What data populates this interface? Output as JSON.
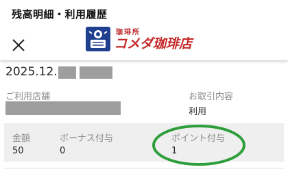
{
  "header": {
    "title": "残高明細・利用履歴",
    "close_icon": "close-icon",
    "logo": {
      "subtext": "珈琲所",
      "main_text": "コメダ珈琲店",
      "brand_color": "#c62828",
      "emblem_icon": "komeda-emblem-icon"
    }
  },
  "detail": {
    "date_prefix": "2025.12.",
    "store_label": "ご利用店舗",
    "transaction_label": "お取引内容",
    "transaction_value": "利用",
    "amount_label": "金額",
    "amount_value": "50",
    "bonus_label": "ボーナス付与",
    "bonus_value": "0",
    "points_label": "ポイント付与",
    "points_value": "1"
  },
  "colors": {
    "summary_bg": "#efefef",
    "label_gray": "#8a8a8a",
    "highlight_circle": "#2e9e3c",
    "redaction": "#9e9e9e"
  }
}
